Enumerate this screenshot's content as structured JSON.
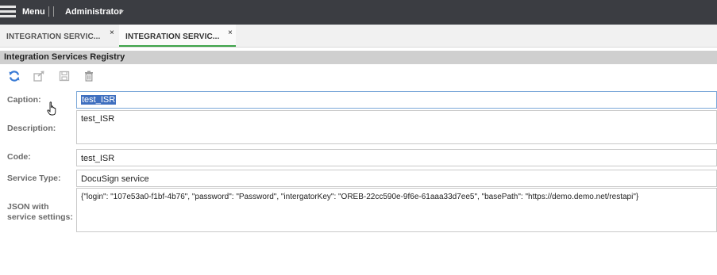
{
  "topbar": {
    "menu_label": "Menu",
    "user_label": "Administrator"
  },
  "tabs": [
    {
      "label": "INTEGRATION SERVIC...",
      "close": "×",
      "active": false
    },
    {
      "label": "INTEGRATION SERVIC...",
      "close": "×",
      "active": true
    }
  ],
  "section": {
    "title": "Integration Services Registry"
  },
  "toolbar": {
    "icons": [
      "refresh-icon",
      "open-external-icon",
      "save-icon",
      "delete-icon"
    ]
  },
  "form": {
    "caption_label": "Caption:",
    "caption_value": "test_ISR",
    "description_label": "Description:",
    "description_value": "test_ISR",
    "code_label": "Code:",
    "code_value": "test_ISR",
    "service_type_label": "Service Type:",
    "service_type_value": "DocuSign service",
    "json_label_line1": "JSON with",
    "json_label_line2": "service settings:",
    "json_value": "{\"login\": \"107e53a0-f1bf-4b76\", \"password\": \"Password\", \"intergatorKey\": \"OREB-22cc590e-9f6e-61aaa33d7ee5\", \"basePath\": \"https://demo.demo.net/restapi\"}"
  },
  "colors": {
    "topbar_bg": "#3b3d42",
    "active_tab_accent": "#3ea34a",
    "toolbar_accent": "#3a7bd5",
    "selection": "#3f6fbf"
  }
}
